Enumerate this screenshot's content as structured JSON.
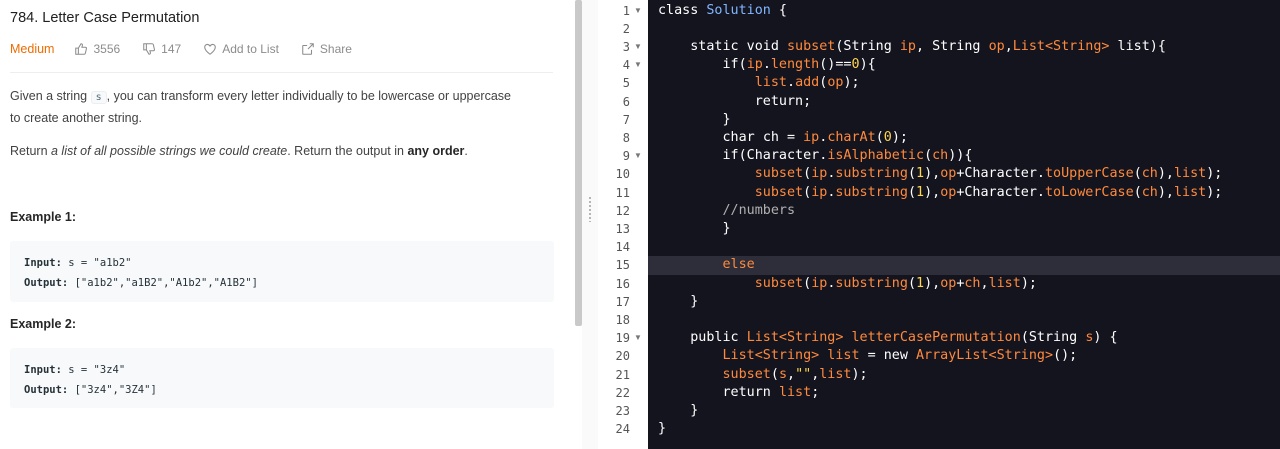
{
  "problem": {
    "title": "784. Letter Case Permutation",
    "difficulty": "Medium",
    "likes": "3556",
    "dislikes": "147",
    "add_to_list": "Add to List",
    "share": "Share",
    "desc_1a": "Given a string ",
    "desc_1code": "s",
    "desc_1b": ", you can transform every letter individually to be lowercase or uppercase",
    "desc_1c": "to create another string.",
    "desc_2a": "Return ",
    "desc_2em": "a list of all possible strings we could create",
    "desc_2b": ". Return the output in ",
    "desc_2strong": "any order",
    "desc_2c": ".",
    "examples": [
      {
        "title": "Example 1:",
        "input_label": "Input:",
        "input": " s = \"a1b2\"",
        "output_label": "Output:",
        "output": " [\"a1b2\",\"a1B2\",\"A1b2\",\"A1B2\"]"
      },
      {
        "title": "Example 2:",
        "input_label": "Input:",
        "input": " s = \"3z4\"",
        "output_label": "Output:",
        "output": " [\"3z4\",\"3Z4\"]"
      }
    ]
  },
  "editor": {
    "line_numbers": [
      "1",
      "2",
      "3",
      "4",
      "5",
      "6",
      "7",
      "8",
      "9",
      "10",
      "11",
      "12",
      "13",
      "14",
      "15",
      "16",
      "17",
      "18",
      "19",
      "20",
      "21",
      "22",
      "23",
      "24"
    ],
    "fold_lines": [
      "1",
      "3",
      "4",
      "9",
      "19"
    ],
    "active_line": "15",
    "code": [
      [
        [
          "class ",
          "kw"
        ],
        [
          "Solution",
          "t-cls"
        ],
        [
          " {",
          "t-pun"
        ]
      ],
      [],
      [
        [
          "    static void ",
          "kw"
        ],
        [
          "subset",
          "t-fn"
        ],
        [
          "(String ",
          "kw"
        ],
        [
          "ip",
          "t-arg"
        ],
        [
          ", String ",
          "kw"
        ],
        [
          "op",
          "t-arg"
        ],
        [
          ",",
          "t-pun"
        ],
        [
          "List<String>",
          "t-type"
        ],
        [
          " list){",
          "kw"
        ]
      ],
      [
        [
          "        if",
          "kw"
        ],
        [
          "(",
          "t-pun"
        ],
        [
          "ip",
          "t-fn"
        ],
        [
          ".",
          "t-pun"
        ],
        [
          "length",
          "t-fn"
        ],
        [
          "()==",
          "t-pun"
        ],
        [
          "0",
          "t-num"
        ],
        [
          "){",
          "t-pun"
        ]
      ],
      [
        [
          "            list",
          "t-fn"
        ],
        [
          ".",
          "t-pun"
        ],
        [
          "add",
          "t-fn"
        ],
        [
          "(",
          "t-pun"
        ],
        [
          "op",
          "t-fn"
        ],
        [
          ");",
          "t-pun"
        ]
      ],
      [
        [
          "            return;",
          "kw"
        ]
      ],
      [
        [
          "        }",
          "t-pun"
        ]
      ],
      [
        [
          "        char ",
          "kw"
        ],
        [
          "ch",
          "kw"
        ],
        [
          " = ",
          "t-pun"
        ],
        [
          "ip",
          "t-fn"
        ],
        [
          ".",
          "t-pun"
        ],
        [
          "charAt",
          "t-fn"
        ],
        [
          "(",
          "t-pun"
        ],
        [
          "0",
          "t-num"
        ],
        [
          ");",
          "t-pun"
        ]
      ],
      [
        [
          "        if",
          "kw"
        ],
        [
          "(Character.",
          "kw"
        ],
        [
          "isAlphabetic",
          "t-fn"
        ],
        [
          "(",
          "t-pun"
        ],
        [
          "ch",
          "t-fn"
        ],
        [
          ")){",
          "t-pun"
        ]
      ],
      [
        [
          "            subset",
          "t-fn"
        ],
        [
          "(",
          "t-pun"
        ],
        [
          "ip",
          "t-fn"
        ],
        [
          ".",
          "t-pun"
        ],
        [
          "substring",
          "t-fn"
        ],
        [
          "(",
          "t-pun"
        ],
        [
          "1",
          "t-num"
        ],
        [
          "),",
          "t-pun"
        ],
        [
          "op",
          "t-fn"
        ],
        [
          "+Character.",
          "kw"
        ],
        [
          "toUpperCase",
          "t-fn"
        ],
        [
          "(",
          "t-pun"
        ],
        [
          "ch",
          "t-fn"
        ],
        [
          "),",
          "t-pun"
        ],
        [
          "list",
          "t-fn"
        ],
        [
          ");",
          "t-pun"
        ]
      ],
      [
        [
          "            subset",
          "t-fn"
        ],
        [
          "(",
          "t-pun"
        ],
        [
          "ip",
          "t-fn"
        ],
        [
          ".",
          "t-pun"
        ],
        [
          "substring",
          "t-fn"
        ],
        [
          "(",
          "t-pun"
        ],
        [
          "1",
          "t-num"
        ],
        [
          "),",
          "t-pun"
        ],
        [
          "op",
          "t-fn"
        ],
        [
          "+Character.",
          "kw"
        ],
        [
          "toLowerCase",
          "t-fn"
        ],
        [
          "(",
          "t-pun"
        ],
        [
          "ch",
          "t-fn"
        ],
        [
          "),",
          "t-pun"
        ],
        [
          "list",
          "t-fn"
        ],
        [
          ");",
          "t-pun"
        ]
      ],
      [
        [
          "        //numbers",
          "t-cm"
        ]
      ],
      [
        [
          "        }",
          "t-pun"
        ]
      ],
      [],
      [
        [
          "        else",
          "t-fn"
        ]
      ],
      [
        [
          "            subset",
          "t-fn"
        ],
        [
          "(",
          "t-pun"
        ],
        [
          "ip",
          "t-fn"
        ],
        [
          ".",
          "t-pun"
        ],
        [
          "substring",
          "t-fn"
        ],
        [
          "(",
          "t-pun"
        ],
        [
          "1",
          "t-num"
        ],
        [
          "),",
          "t-pun"
        ],
        [
          "op",
          "t-fn"
        ],
        [
          "+",
          "t-pun"
        ],
        [
          "ch",
          "t-fn"
        ],
        [
          ",",
          "t-pun"
        ],
        [
          "list",
          "t-fn"
        ],
        [
          ");",
          "t-pun"
        ]
      ],
      [
        [
          "    }",
          "t-pun"
        ]
      ],
      [],
      [
        [
          "    public ",
          "kw"
        ],
        [
          "List<String>",
          "t-type"
        ],
        [
          " letterCasePermutation",
          "t-fn"
        ],
        [
          "(String ",
          "kw"
        ],
        [
          "s",
          "t-arg"
        ],
        [
          ") {",
          "kw"
        ]
      ],
      [
        [
          "        List<String>",
          "t-type"
        ],
        [
          " list",
          "t-fn"
        ],
        [
          " = ",
          "t-pun"
        ],
        [
          "new ",
          "kw"
        ],
        [
          "ArrayList<String>",
          "t-type"
        ],
        [
          "();",
          "t-pun"
        ]
      ],
      [
        [
          "        subset",
          "t-fn"
        ],
        [
          "(",
          "t-pun"
        ],
        [
          "s",
          "t-fn"
        ],
        [
          ",",
          "t-pun"
        ],
        [
          "\"\"",
          "t-str"
        ],
        [
          ",",
          "t-pun"
        ],
        [
          "list",
          "t-fn"
        ],
        [
          ");",
          "t-pun"
        ]
      ],
      [
        [
          "        return ",
          "kw"
        ],
        [
          "list",
          "t-fn"
        ],
        [
          ";",
          "t-pun"
        ]
      ],
      [
        [
          "    }",
          "t-pun"
        ]
      ],
      [
        [
          "}",
          "t-pun"
        ]
      ]
    ]
  }
}
